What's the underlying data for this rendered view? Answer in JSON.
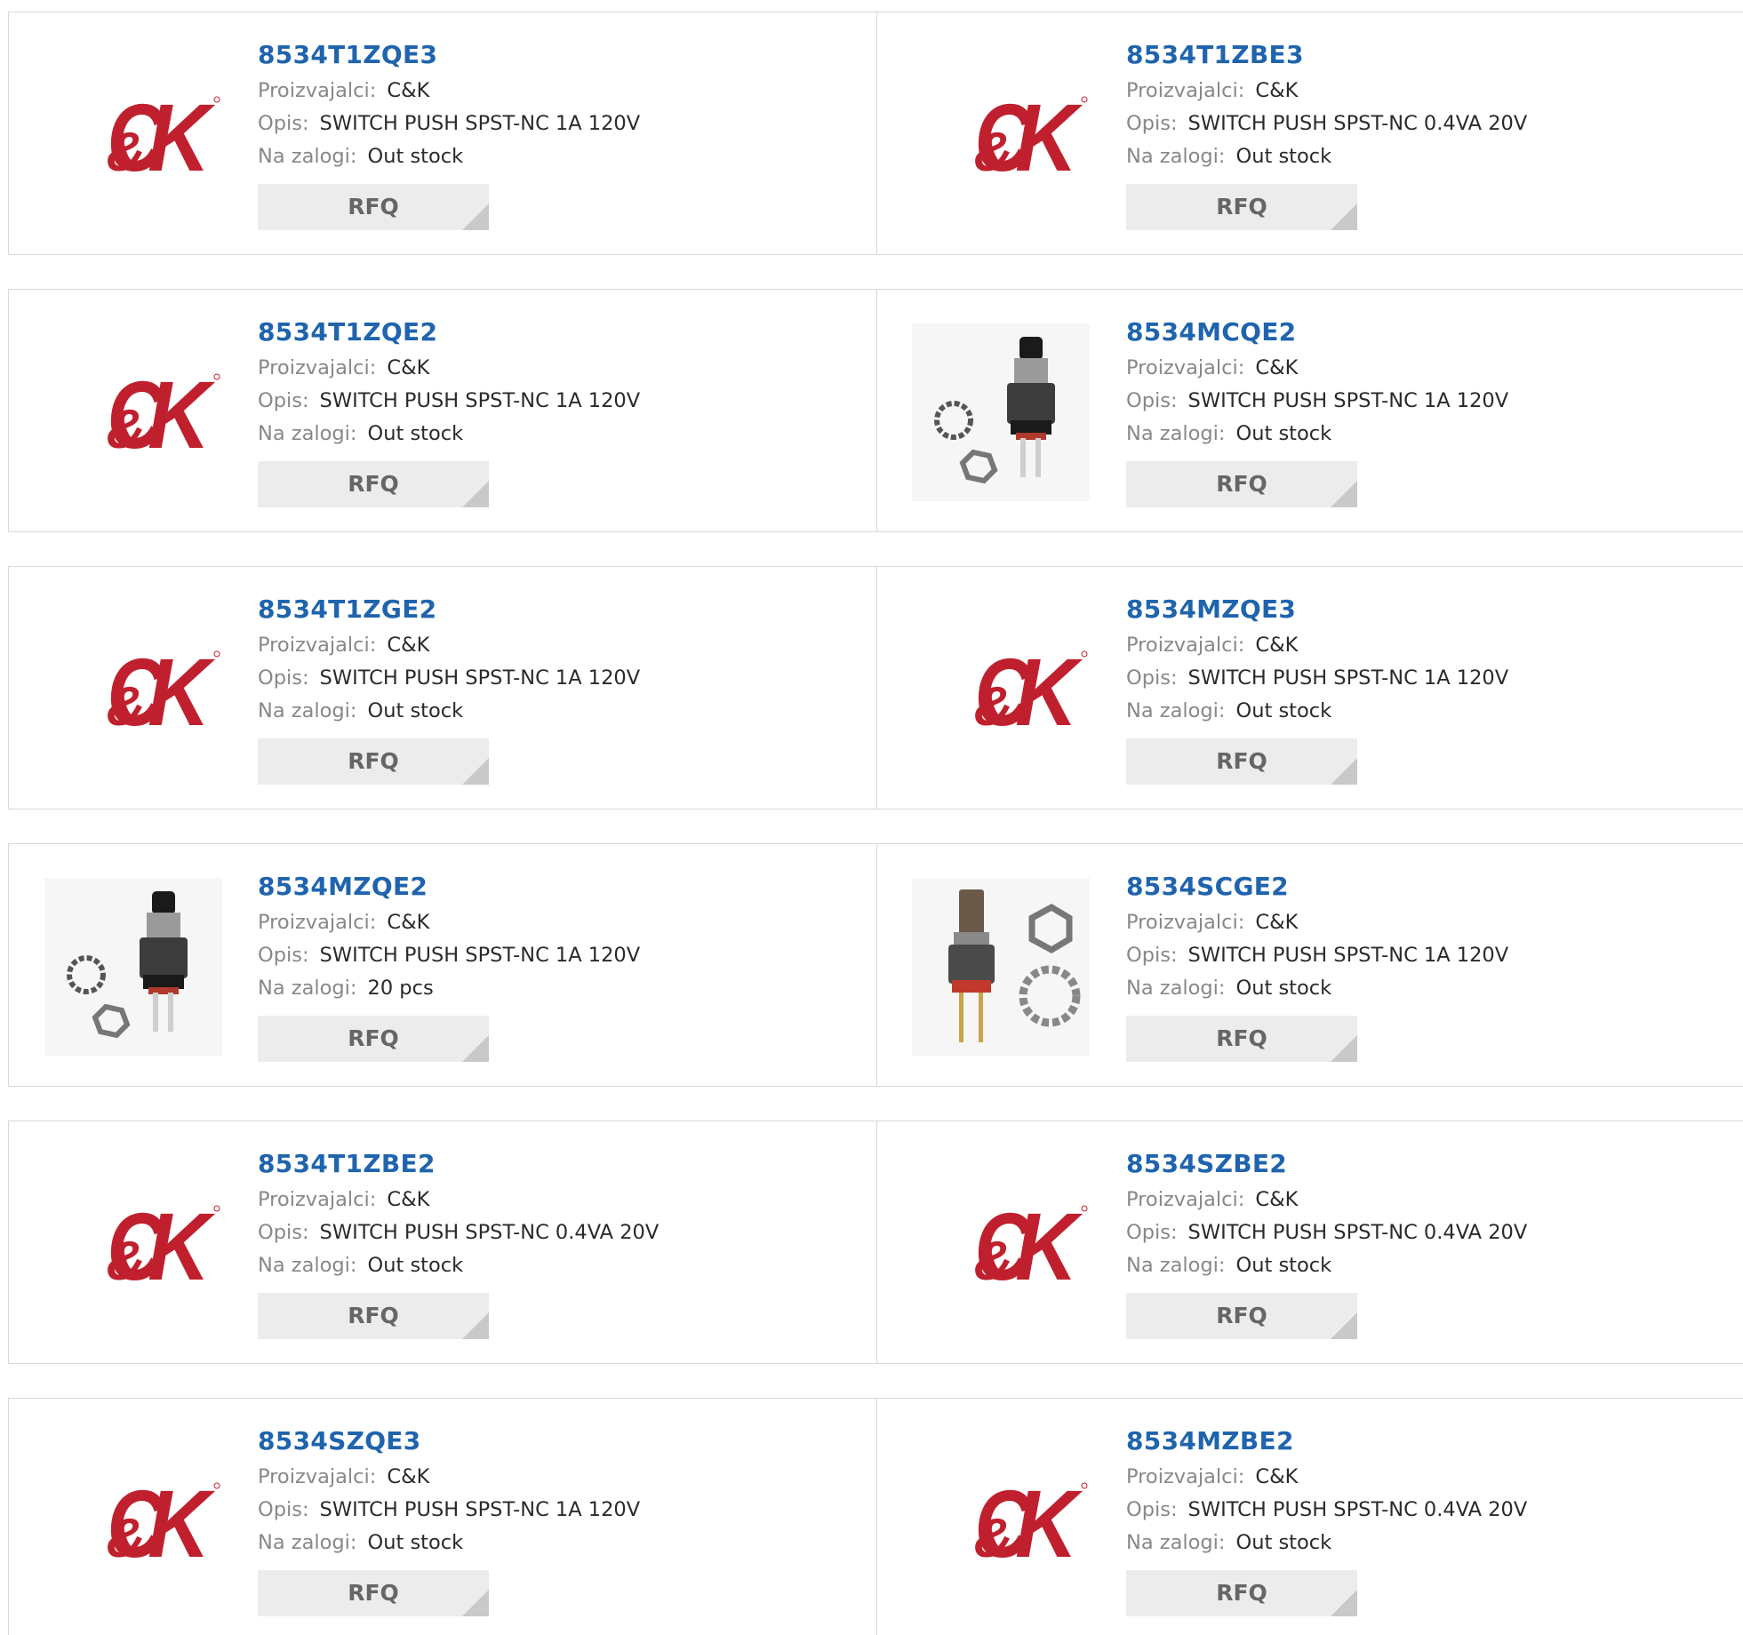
{
  "labels": {
    "manufacturer": "Proizvajalci:",
    "description": "Opis:",
    "stock": "Na zalogi:",
    "rfq": "RFQ"
  },
  "colors": {
    "part_link": "#1f64ad",
    "logo_red": "#c0202e",
    "rfq_bg": "#ececec"
  },
  "logo_text": "C&K",
  "rows": [
    {
      "left": {
        "part": "8534T1ZQE3",
        "manufacturer": "C&K",
        "description": "SWITCH PUSH SPST-NC 1A 120V",
        "stock": "Out stock",
        "image": "ck-logo"
      },
      "right": {
        "part": "8534T1ZBE3",
        "manufacturer": "C&K",
        "description": "SWITCH PUSH SPST-NC 0.4VA 20V",
        "stock": "Out stock",
        "image": "ck-logo"
      }
    },
    {
      "left": {
        "part": "8534T1ZQE2",
        "manufacturer": "C&K",
        "description": "SWITCH PUSH SPST-NC 1A 120V",
        "stock": "Out stock",
        "image": "ck-logo"
      },
      "right": {
        "part": "8534MCQE2",
        "manufacturer": "C&K",
        "description": "SWITCH PUSH SPST-NC 1A 120V",
        "stock": "Out stock",
        "image": "switch-photo-a"
      }
    },
    {
      "left": {
        "part": "8534T1ZGE2",
        "manufacturer": "C&K",
        "description": "SWITCH PUSH SPST-NC 1A 120V",
        "stock": "Out stock",
        "image": "ck-logo"
      },
      "right": {
        "part": "8534MZQE3",
        "manufacturer": "C&K",
        "description": "SWITCH PUSH SPST-NC 1A 120V",
        "stock": "Out stock",
        "image": "ck-logo"
      }
    },
    {
      "left": {
        "part": "8534MZQE2",
        "manufacturer": "C&K",
        "description": "SWITCH PUSH SPST-NC 1A 120V",
        "stock": "20 pcs",
        "image": "switch-photo-a"
      },
      "right": {
        "part": "8534SCGE2",
        "manufacturer": "C&K",
        "description": "SWITCH PUSH SPST-NC 1A 120V",
        "stock": "Out stock",
        "image": "switch-photo-b"
      }
    },
    {
      "left": {
        "part": "8534T1ZBE2",
        "manufacturer": "C&K",
        "description": "SWITCH PUSH SPST-NC 0.4VA 20V",
        "stock": "Out stock",
        "image": "ck-logo"
      },
      "right": {
        "part": "8534SZBE2",
        "manufacturer": "C&K",
        "description": "SWITCH PUSH SPST-NC 0.4VA 20V",
        "stock": "Out stock",
        "image": "ck-logo"
      }
    },
    {
      "left": {
        "part": "8534SZQE3",
        "manufacturer": "C&K",
        "description": "SWITCH PUSH SPST-NC 1A 120V",
        "stock": "Out stock",
        "image": "ck-logo"
      },
      "right": {
        "part": "8534MZBE2",
        "manufacturer": "C&K",
        "description": "SWITCH PUSH SPST-NC 0.4VA 20V",
        "stock": "Out stock",
        "image": "ck-logo"
      }
    }
  ]
}
